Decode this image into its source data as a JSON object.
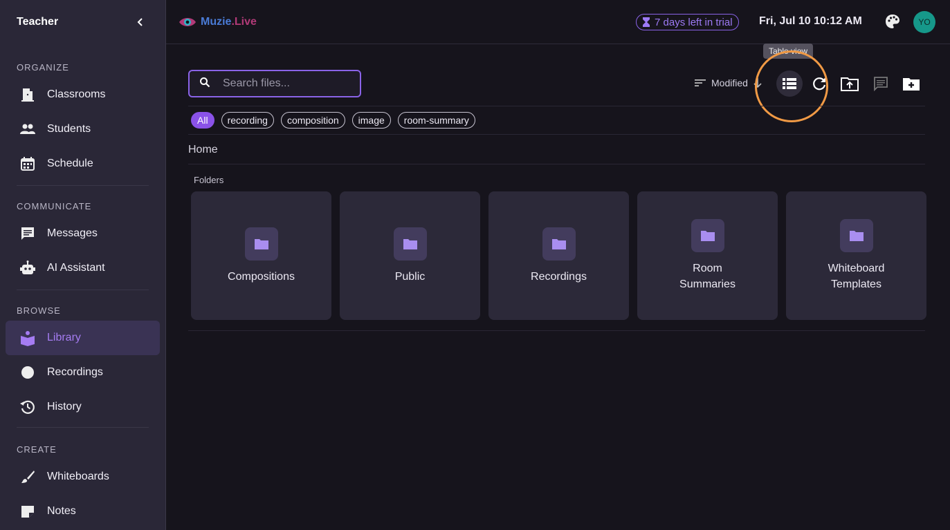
{
  "sidebar": {
    "title": "Teacher",
    "sections": [
      {
        "title": "ORGANIZE",
        "items": [
          {
            "label": "Classrooms",
            "icon": "door-icon"
          },
          {
            "label": "Students",
            "icon": "people-icon"
          },
          {
            "label": "Schedule",
            "icon": "calendar-icon"
          }
        ]
      },
      {
        "title": "COMMUNICATE",
        "items": [
          {
            "label": "Messages",
            "icon": "chat-icon"
          },
          {
            "label": "AI Assistant",
            "icon": "robot-icon"
          }
        ]
      },
      {
        "title": "BROWSE",
        "items": [
          {
            "label": "Library",
            "icon": "library-icon",
            "active": true
          },
          {
            "label": "Recordings",
            "icon": "record-icon"
          },
          {
            "label": "History",
            "icon": "history-icon"
          }
        ]
      },
      {
        "title": "CREATE",
        "items": [
          {
            "label": "Whiteboards",
            "icon": "brush-icon"
          },
          {
            "label": "Notes",
            "icon": "note-icon"
          }
        ]
      }
    ]
  },
  "header": {
    "logo_part1": "Muzie",
    "logo_part2": ".Live",
    "trial_text": "7 days left in trial",
    "datetime": "Fri, Jul 10 10:12 AM",
    "avatar_initials": "YO"
  },
  "search": {
    "placeholder": "Search files..."
  },
  "sort": {
    "label": "Modified"
  },
  "tooltip": "Table view",
  "filters": [
    "All",
    "recording",
    "composition",
    "image",
    "room-summary"
  ],
  "breadcrumb": "Home",
  "folders_label": "Folders",
  "folders": [
    "Compositions",
    "Public",
    "Recordings",
    "Room Summaries",
    "Whiteboard Templates"
  ],
  "colors": {
    "accent": "#8a63e8",
    "highlight": "#f19a45",
    "avatar": "#16988a"
  }
}
